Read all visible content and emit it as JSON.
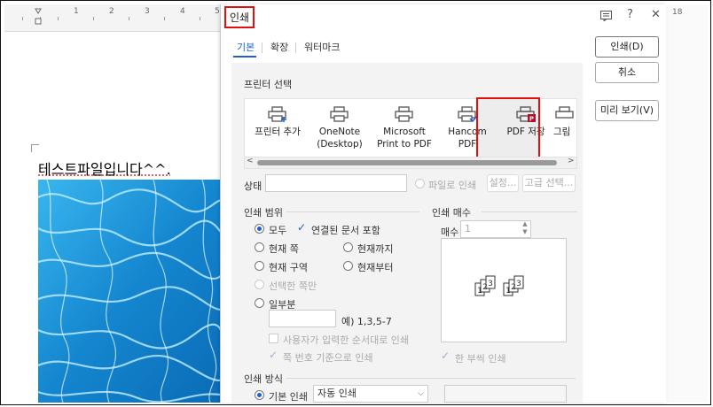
{
  "document": {
    "ruler_numbers": [
      "1",
      "2",
      "3",
      "4",
      "5"
    ],
    "right_ruler_number": "18",
    "body_text": "테스트파일입니다^^."
  },
  "dialog": {
    "title": "인쇄",
    "titlebar_icons": [
      "help-box-icon",
      "question-icon",
      "close-icon"
    ],
    "question_glyph": "?",
    "close_glyph": "✕",
    "tabs": [
      {
        "label": "기본",
        "active": true
      },
      {
        "label": "확장",
        "active": false
      },
      {
        "label": "워터마크",
        "active": false
      }
    ],
    "printer_section": "프린터 선택",
    "printers": [
      {
        "line1": "프린터 추가",
        "line2": "",
        "icon": "printer-add-icon"
      },
      {
        "line1": "OneNote",
        "line2": "(Desktop)",
        "icon": "printer-icon"
      },
      {
        "line1": "Microsoft",
        "line2": "Print to PDF",
        "icon": "printer-icon"
      },
      {
        "line1": "Hancom PDF",
        "line2": "",
        "icon": "printer-check-icon"
      },
      {
        "line1": "PDF 저장",
        "line2": "",
        "icon": "pdf-printer-icon",
        "selected": true
      },
      {
        "line1": "그림",
        "line2": "",
        "icon": "printer-icon"
      }
    ],
    "status_label": "상태",
    "print_to_file_label": "파일로 인쇄",
    "settings_button": "설정...",
    "advanced_button": "고급 선택...",
    "range": {
      "heading": "인쇄 범위",
      "all": "모두",
      "include_linked": "연결된 문서 포함",
      "current_page": "현재 쪽",
      "up_to_current": "현재까지",
      "current_section": "현재 구역",
      "from_current": "현재부터",
      "selection_only": "선택한 쪽만",
      "some_pages": "일부분",
      "pages_example": "예) 1,3,5-7",
      "user_order": "사용자가 입력한 순서대로 인쇄",
      "page_number_based": "쪽 번호 기준으로 인쇄"
    },
    "copies": {
      "heading": "인쇄 매수",
      "label": "매수",
      "value": "1",
      "collate": "한 부씩 인쇄"
    },
    "method": {
      "heading": "인쇄 방식",
      "basic": "기본 인쇄",
      "auto": "자동 인쇄"
    },
    "buttons": {
      "print": "인쇄(D)",
      "cancel": "취소",
      "preview": "미리 보기(V)"
    },
    "accent": "#1b5fd0",
    "highlight": "#e01010"
  }
}
